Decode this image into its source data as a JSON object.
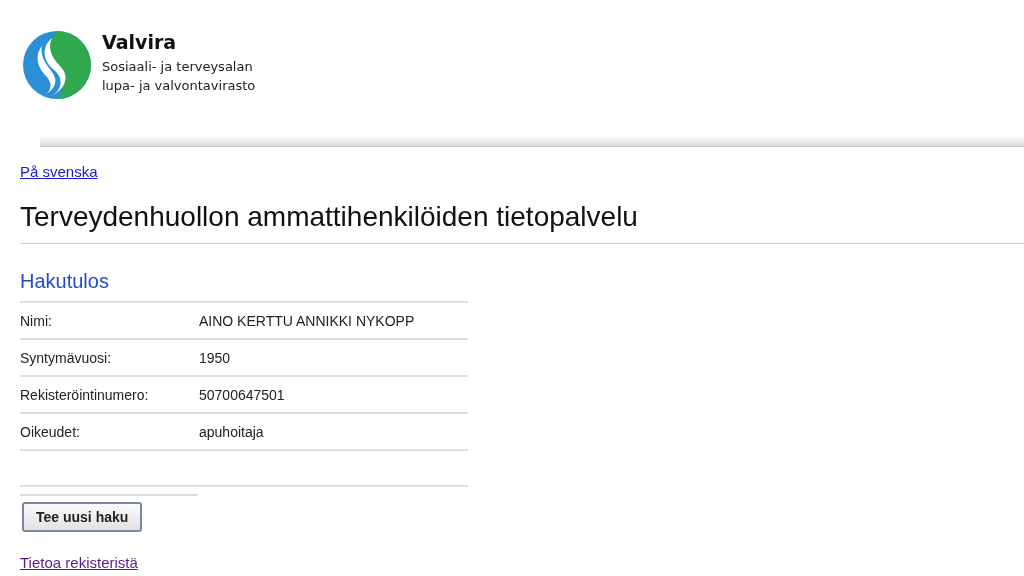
{
  "header": {
    "brand": "Valvira",
    "tagline_1": "Sosiaali- ja terveysalan",
    "tagline_2": "lupa- ja valvontavirasto"
  },
  "language_link": "På svenska",
  "page_title": "Terveydenhuollon ammattihenkilöiden tietopalvelu",
  "result": {
    "heading": "Hakutulos",
    "rows": [
      {
        "label": "Nimi:",
        "value": "AINO KERTTU ANNIKKI NYKOPP"
      },
      {
        "label": "Syntymävuosi:",
        "value": "1950"
      },
      {
        "label": "Rekisteröintinumero:",
        "value": "50700647501"
      },
      {
        "label": "Oikeudet:",
        "value": "apuhoitaja"
      }
    ]
  },
  "new_search_button": "Tee uusi haku",
  "footer_links": [
    {
      "label": "Tietoa rekisteristä",
      "visited": true
    }
  ]
}
